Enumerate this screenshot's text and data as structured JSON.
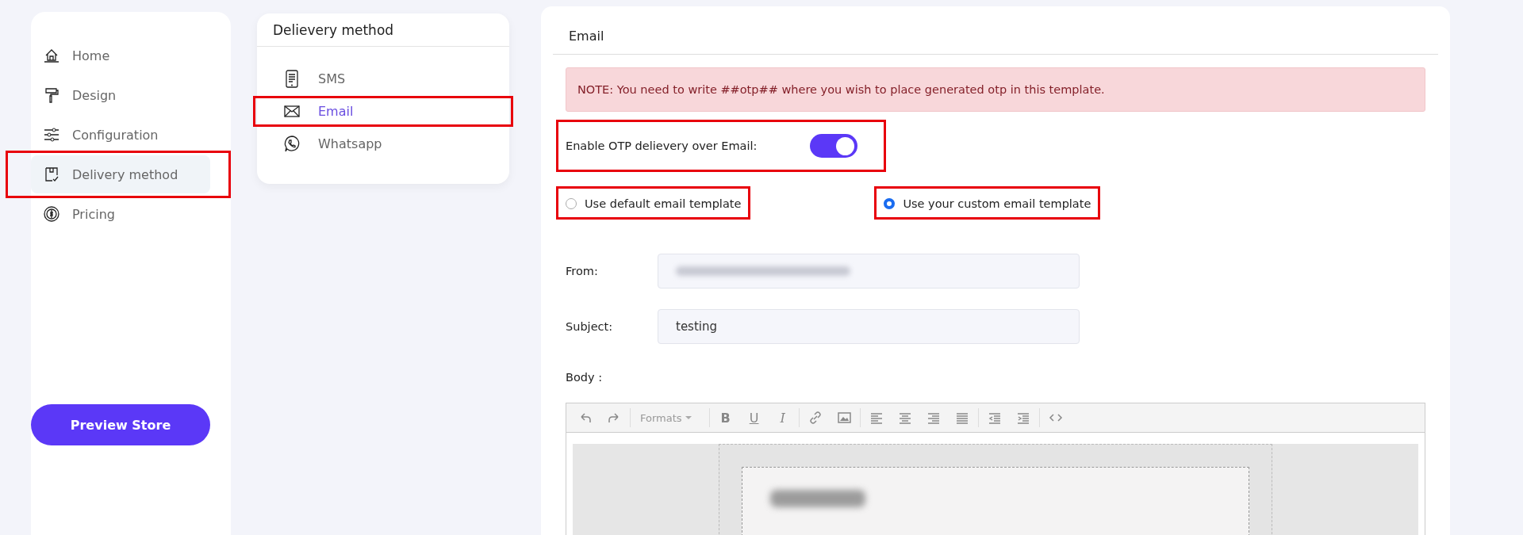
{
  "sidebar": {
    "items": [
      {
        "label": "Home",
        "selected": false,
        "highlighted": false
      },
      {
        "label": "Design",
        "selected": false,
        "highlighted": false
      },
      {
        "label": "Configuration",
        "selected": false,
        "highlighted": false
      },
      {
        "label": "Delivery method",
        "selected": true,
        "highlighted": true
      },
      {
        "label": "Pricing",
        "selected": false,
        "highlighted": false
      }
    ],
    "button": "Preview Store"
  },
  "methods": {
    "title": "Delievery method",
    "items": [
      {
        "label": "SMS",
        "selected": false,
        "highlighted": false
      },
      {
        "label": "Email",
        "selected": true,
        "highlighted": true
      },
      {
        "label": "Whatsapp",
        "selected": false,
        "highlighted": false
      }
    ]
  },
  "email_panel": {
    "title": "Email",
    "note": "NOTE: You need to write ##otp## where you wish to place generated otp in this template.",
    "toggle": {
      "label": "Enable OTP delievery over Email:",
      "on": true,
      "highlighted": true
    },
    "template_options": [
      {
        "label": "Use default email template",
        "selected": false,
        "highlighted": true
      },
      {
        "label": "Use your custom email template",
        "selected": true,
        "highlighted": true
      }
    ],
    "fields": [
      {
        "label": "From:",
        "kind": "blurred"
      },
      {
        "label": "Subject:",
        "kind": "text",
        "value": "testing"
      }
    ],
    "body_label": "Body :",
    "editor": {
      "formats": "Formats",
      "style_buttons": [
        "B",
        "U",
        "I"
      ]
    }
  }
}
